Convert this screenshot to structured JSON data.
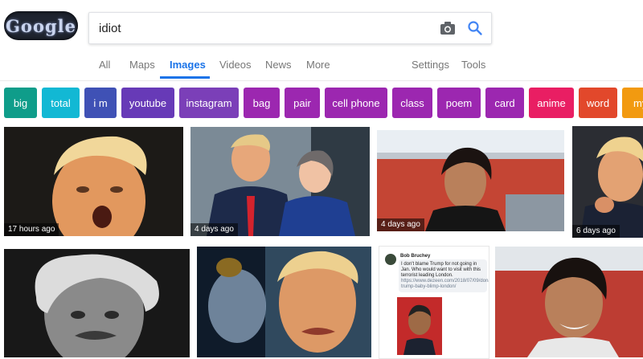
{
  "logo": {
    "text": "Google"
  },
  "search": {
    "query": "idiot"
  },
  "tabs": {
    "all": "All",
    "maps": "Maps",
    "images": "Images",
    "videos": "Videos",
    "news": "News",
    "more": "More",
    "settings": "Settings",
    "tools": "Tools"
  },
  "chips": [
    {
      "label": "big",
      "color": "#0f9d8a"
    },
    {
      "label": "total",
      "color": "#12b8d4"
    },
    {
      "label": "i m",
      "color": "#3f51b5"
    },
    {
      "label": "youtube",
      "color": "#673ab7"
    },
    {
      "label": "instagram",
      "color": "#7b3fb8"
    },
    {
      "label": "bag",
      "color": "#9c27b0"
    },
    {
      "label": "pair",
      "color": "#9c27b0"
    },
    {
      "label": "cell phone",
      "color": "#9c27b0"
    },
    {
      "label": "class",
      "color": "#9c27b0"
    },
    {
      "label": "poem",
      "color": "#9c27b0"
    },
    {
      "label": "card",
      "color": "#9c27b0"
    },
    {
      "label": "anime",
      "color": "#e91e63"
    },
    {
      "label": "word",
      "color": "#e2482b"
    },
    {
      "label": "my",
      "color": "#f29a10"
    }
  ],
  "results": [
    {
      "timestamp": "17 hours ago"
    },
    {
      "timestamp": "4 days ago"
    },
    {
      "timestamp": "4 days ago"
    },
    {
      "timestamp": "6 days ago"
    },
    {
      "timestamp": ""
    },
    {
      "timestamp": ""
    },
    {
      "timestamp": ""
    },
    {
      "timestamp": ""
    }
  ],
  "tweet": {
    "name": "Bob Bruchey",
    "text": "I don't blame Trump for not going in Jan. Who would want to visit with this terrorist leading London.",
    "link": "https://www.dezeen.com/2018/07/09/donald-trump-baby-blimp-london/"
  }
}
